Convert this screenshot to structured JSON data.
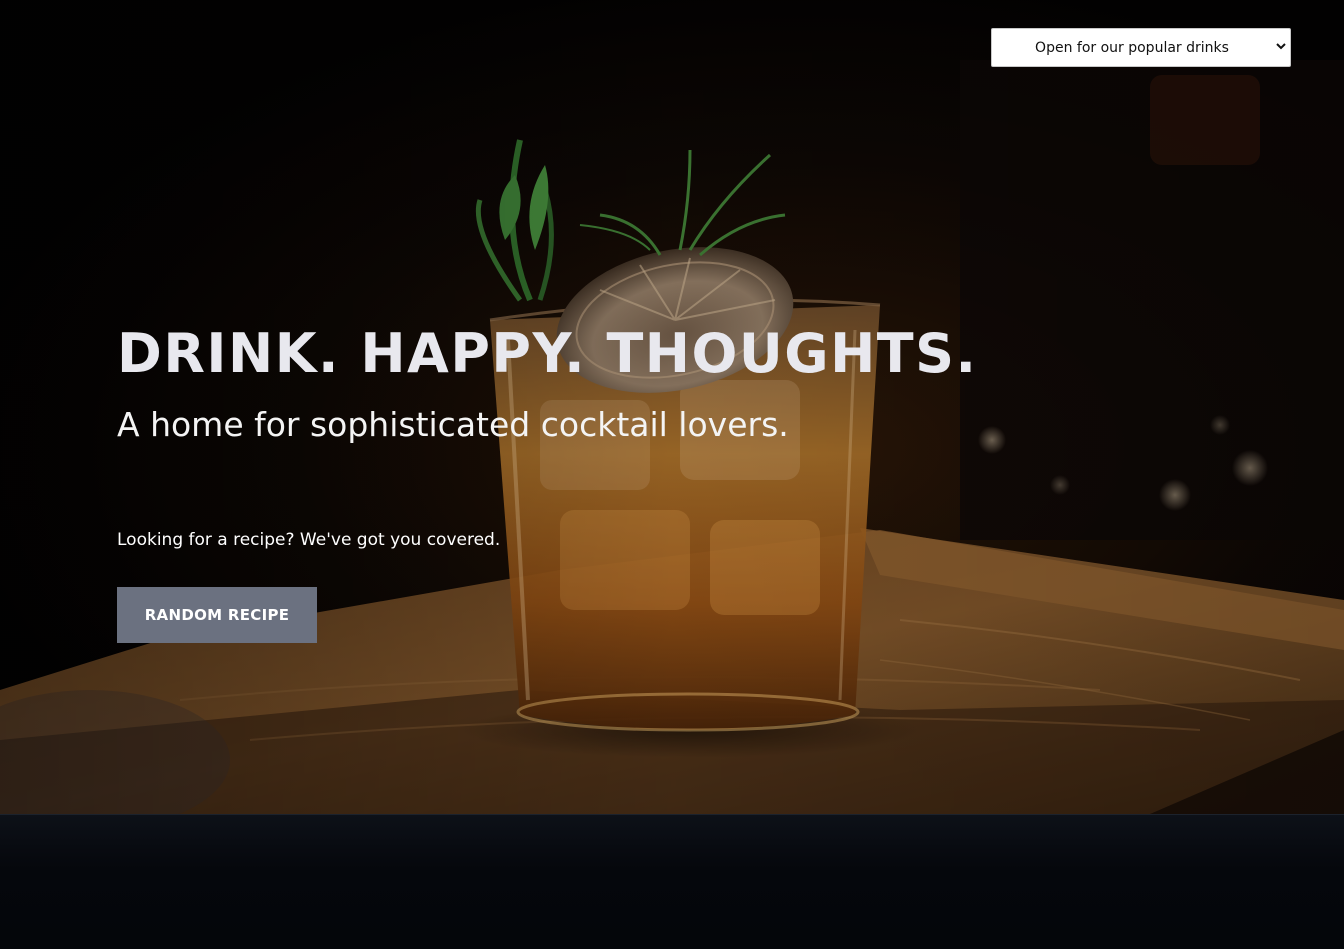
{
  "nav": {
    "drinks_select": {
      "selected": "Open for our popular drinks",
      "options": [
        "Open for our popular drinks"
      ],
      "chevron_icon": "chevron-down-icon"
    }
  },
  "hero": {
    "title": "DRINK. HAPPY. THOUGHTS.",
    "subtitle": "A home for sophisticated cocktail lovers.",
    "recipe_prompt": "Looking for a recipe? We've got you covered.",
    "random_button_label": "RANDOM RECIPE",
    "image_subject": "cocktail-glass-on-wooden-tray"
  },
  "colors": {
    "button_bg": "#6b7180",
    "title_text": "#e8e8ee",
    "body_text": "#ffffff",
    "page_bg": "#05070c"
  }
}
